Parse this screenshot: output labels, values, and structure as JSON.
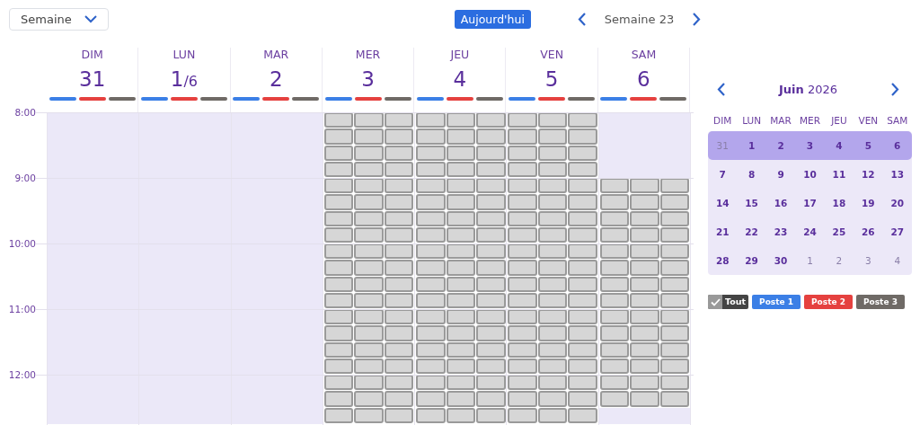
{
  "view_select": {
    "value": "Semaine"
  },
  "today_button": "Aujourd'hui",
  "week_label": "Semaine 23",
  "postes": [
    {
      "color": "#3b7fe6"
    },
    {
      "color": "#e5413f"
    },
    {
      "color": "#6f6a66"
    }
  ],
  "days": [
    {
      "label": "DIM",
      "number": "31",
      "slots": [
        false,
        false,
        false,
        false,
        false,
        false,
        false,
        false,
        false,
        false,
        false,
        false,
        false,
        false,
        false,
        false,
        false,
        false,
        false
      ]
    },
    {
      "label": "LUN",
      "number": "1",
      "suffix": "/6",
      "slots": [
        false,
        false,
        false,
        false,
        false,
        false,
        false,
        false,
        false,
        false,
        false,
        false,
        false,
        false,
        false,
        false,
        false,
        false,
        false
      ]
    },
    {
      "label": "MAR",
      "number": "2",
      "slots": [
        false,
        false,
        false,
        false,
        false,
        false,
        false,
        false,
        false,
        false,
        false,
        false,
        false,
        false,
        false,
        false,
        false,
        false,
        false
      ]
    },
    {
      "label": "MER",
      "number": "3",
      "slots": [
        true,
        true,
        true,
        true,
        true,
        true,
        true,
        true,
        true,
        true,
        true,
        true,
        true,
        true,
        true,
        true,
        true,
        true,
        true
      ]
    },
    {
      "label": "JEU",
      "number": "4",
      "slots": [
        true,
        true,
        true,
        true,
        true,
        true,
        true,
        true,
        true,
        true,
        true,
        true,
        true,
        true,
        true,
        true,
        true,
        true,
        true
      ]
    },
    {
      "label": "VEN",
      "number": "5",
      "slots": [
        true,
        true,
        true,
        true,
        true,
        true,
        true,
        true,
        true,
        true,
        true,
        true,
        true,
        true,
        true,
        true,
        true,
        true,
        true
      ]
    },
    {
      "label": "SAM",
      "number": "6",
      "slots": [
        false,
        false,
        false,
        false,
        true,
        true,
        true,
        true,
        true,
        true,
        true,
        true,
        true,
        true,
        true,
        true,
        true,
        true,
        false
      ]
    }
  ],
  "hours": [
    "8:00",
    "9:00",
    "10:00",
    "11:00",
    "12:00"
  ],
  "mini_calendar": {
    "title": "**Juin** 2026",
    "weekdays": [
      "DIM",
      "LUN",
      "MAR",
      "MER",
      "JEU",
      "VEN",
      "SAM"
    ],
    "weeks": [
      {
        "selected": true,
        "days": [
          {
            "n": "31",
            "outside": true
          },
          {
            "n": "1",
            "outside": false
          },
          {
            "n": "2",
            "outside": false
          },
          {
            "n": "3",
            "outside": false
          },
          {
            "n": "4",
            "outside": false
          },
          {
            "n": "5",
            "outside": false
          },
          {
            "n": "6",
            "outside": false
          }
        ]
      },
      {
        "selected": false,
        "days": [
          {
            "n": "7",
            "outside": false
          },
          {
            "n": "8",
            "outside": false
          },
          {
            "n": "9",
            "outside": false
          },
          {
            "n": "10",
            "outside": false
          },
          {
            "n": "11",
            "outside": false
          },
          {
            "n": "12",
            "outside": false
          },
          {
            "n": "13",
            "outside": false
          }
        ]
      },
      {
        "selected": false,
        "days": [
          {
            "n": "14",
            "outside": false
          },
          {
            "n": "15",
            "outside": false
          },
          {
            "n": "16",
            "outside": false
          },
          {
            "n": "17",
            "outside": false
          },
          {
            "n": "18",
            "outside": false
          },
          {
            "n": "19",
            "outside": false
          },
          {
            "n": "20",
            "outside": false
          }
        ]
      },
      {
        "selected": false,
        "days": [
          {
            "n": "21",
            "outside": false
          },
          {
            "n": "22",
            "outside": false
          },
          {
            "n": "23",
            "outside": false
          },
          {
            "n": "24",
            "outside": false
          },
          {
            "n": "25",
            "outside": false
          },
          {
            "n": "26",
            "outside": false
          },
          {
            "n": "27",
            "outside": false
          }
        ]
      },
      {
        "selected": false,
        "days": [
          {
            "n": "28",
            "outside": false
          },
          {
            "n": "29",
            "outside": false
          },
          {
            "n": "30",
            "outside": false
          },
          {
            "n": "1",
            "outside": true
          },
          {
            "n": "2",
            "outside": true
          },
          {
            "n": "3",
            "outside": true
          },
          {
            "n": "4",
            "outside": true
          }
        ]
      }
    ]
  },
  "filters": [
    {
      "kind": "all",
      "label": "Tout",
      "checked": true
    },
    {
      "kind": "poste",
      "label": "Poste 1",
      "color": "#3b7fe6"
    },
    {
      "kind": "poste",
      "label": "Poste 2",
      "color": "#e5413f"
    },
    {
      "kind": "poste",
      "label": "Poste 3",
      "color": "#6f6a66"
    }
  ]
}
